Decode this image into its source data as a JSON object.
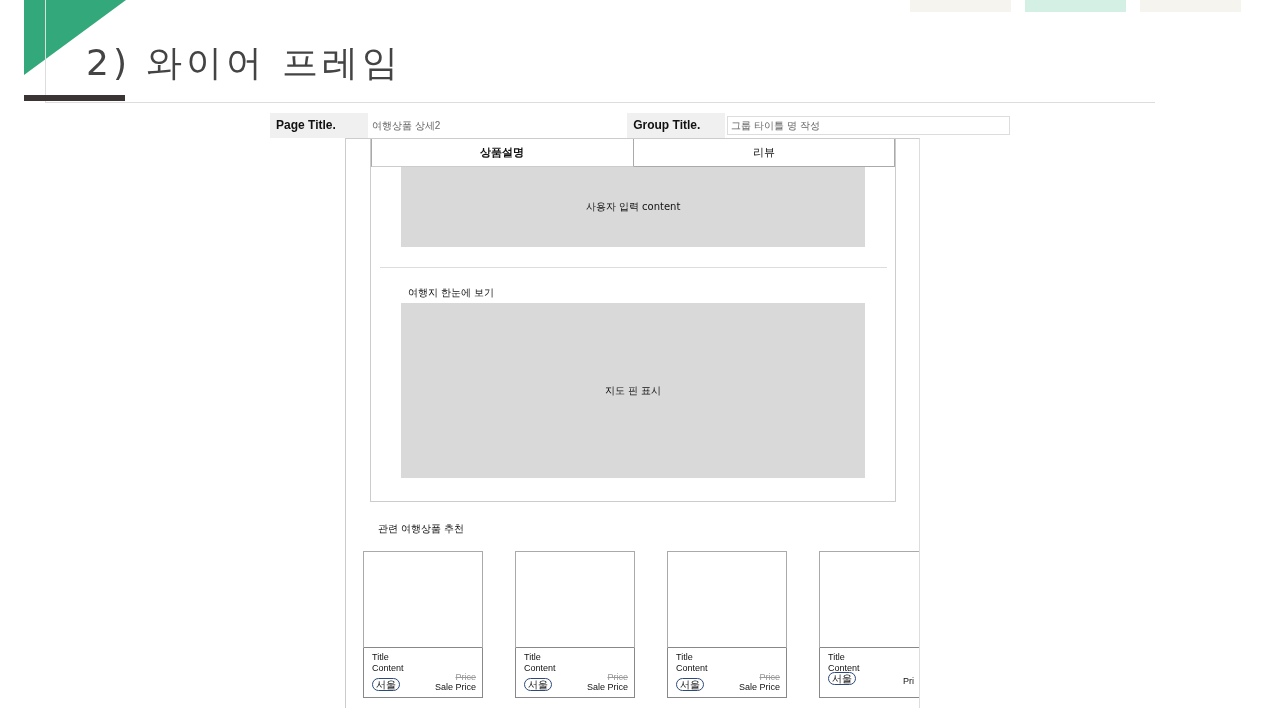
{
  "slide_tabs": [
    {
      "selected": false
    },
    {
      "selected": true
    },
    {
      "selected": false
    }
  ],
  "heading": "2) 와이어 프레임",
  "header": {
    "page_title_label": "Page Title.",
    "page_title_value": "여행상품 상세2",
    "group_title_label": "Group Title.",
    "group_title_placeholder": "그룹 타이틀 명 작성"
  },
  "tabs": [
    {
      "label": "상품설명",
      "selected": true
    },
    {
      "label": "리뷰",
      "selected": false
    }
  ],
  "content_placeholder": "사용자 입력 content",
  "map_section": {
    "title": "여행지 한눈에 보기",
    "placeholder": "지도 핀 표시"
  },
  "recommend": {
    "title": "관련 여행상품 추천",
    "cards": [
      {
        "title": "Title",
        "content": "Content",
        "tag": "서울",
        "price": "Price",
        "sale_price": "Sale Price"
      },
      {
        "title": "Title",
        "content": "Content",
        "tag": "서울",
        "price": "Price",
        "sale_price": "Sale Price"
      },
      {
        "title": "Title",
        "content": "Content",
        "tag": "서울",
        "price": "Price",
        "sale_price": "Sale Price"
      },
      {
        "title": "Title",
        "content": "Content",
        "tag": "서울",
        "sale_price": "Pri"
      }
    ]
  }
}
